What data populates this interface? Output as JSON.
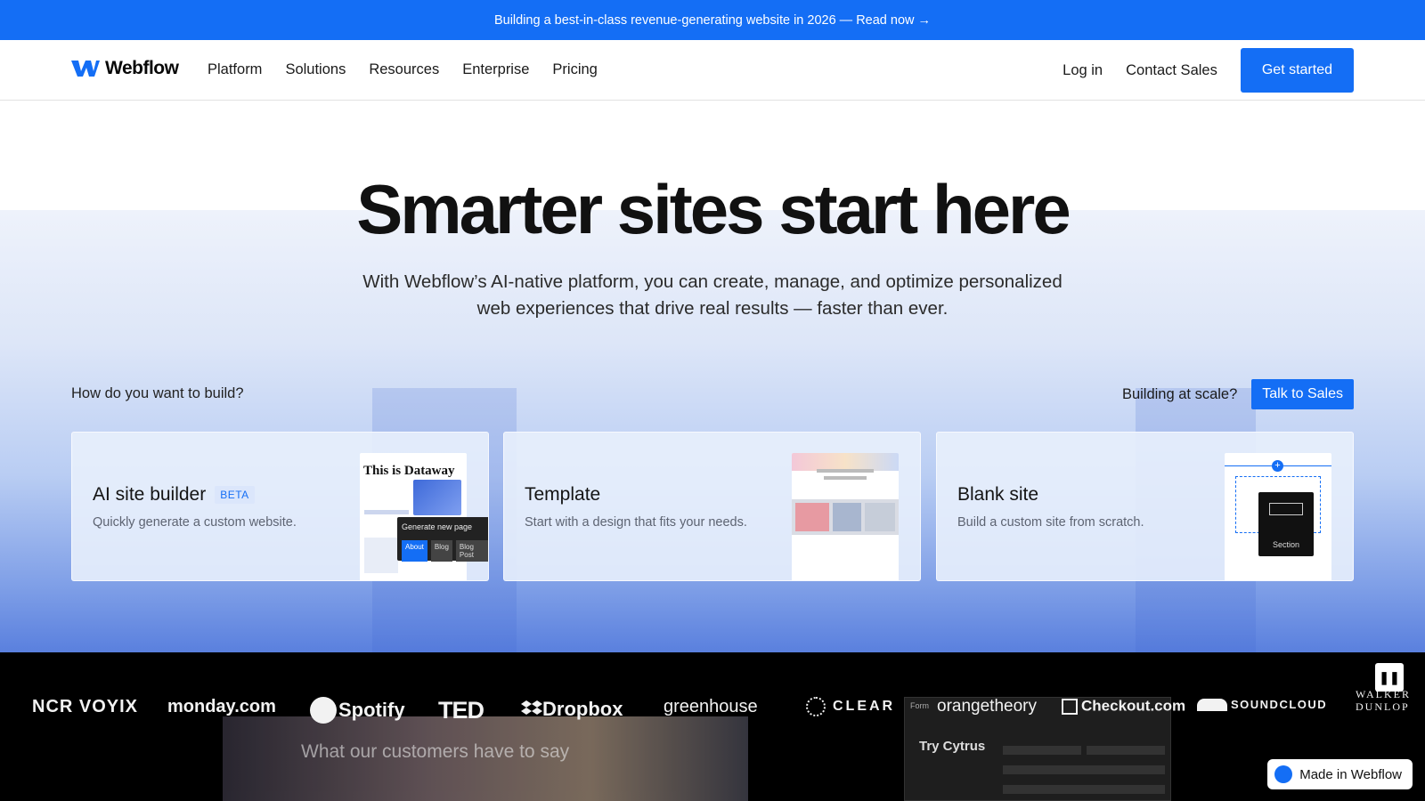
{
  "banner": {
    "text": "Building a best-in-class revenue-generating website in 2026 — Read now →"
  },
  "nav": {
    "logo_text": "Webflow",
    "links": [
      "Platform",
      "Solutions",
      "Resources",
      "Enterprise",
      "Pricing"
    ],
    "login": "Log in",
    "contact": "Contact Sales",
    "cta": "Get started"
  },
  "hero": {
    "headline": "Smarter sites start here",
    "subhead": "With Webflow’s AI-native platform, you can create, manage, and optimize personalized web experiences that drive real results — faster than ever."
  },
  "build": {
    "question": "How do you want to build?",
    "scale_label": "Building at scale?",
    "talk_button": "Talk to Sales"
  },
  "cards": [
    {
      "title": "AI site builder",
      "badge": "BETA",
      "desc": "Quickly generate a custom website.",
      "thumb_title": "This is Dataway",
      "thumb_popup": "Generate new page",
      "thumb_chips": [
        "About",
        "Blog",
        "Blog Post"
      ]
    },
    {
      "title": "Template",
      "desc": "Start with a design that fits your needs."
    },
    {
      "title": "Blank site",
      "desc": "Build a custom site from scratch.",
      "thumb_label": "Section"
    }
  ],
  "logos": [
    "NCR VOYIX",
    "monday.com",
    "Spotify",
    "TED",
    "Dropbox",
    "greenhouse",
    "CLEAR",
    "orangetheory",
    "Checkout.com",
    "SOUNDCLOUD",
    "WALKER DUNLOP"
  ],
  "video": {
    "caption": "What our customers have to say",
    "form_title": "Try Cytrus",
    "form_label": "Form"
  },
  "made_in": "Made in Webflow",
  "colors": {
    "brand_blue": "#146ef5",
    "dark": "#000000"
  }
}
